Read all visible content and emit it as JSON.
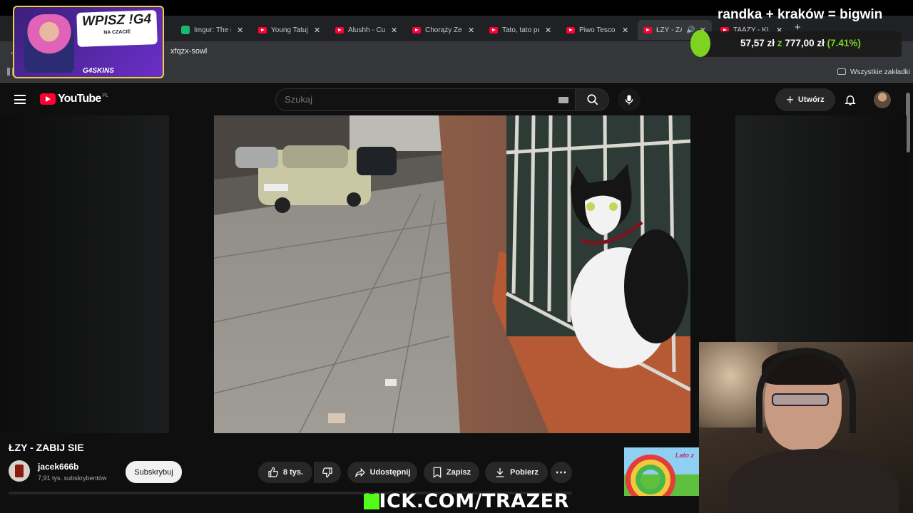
{
  "browser": {
    "tabs": [
      {
        "title": "Imgur: The m",
        "type": "imgur"
      },
      {
        "title": "Young Tatuje",
        "type": "youtube"
      },
      {
        "title": "Alushh - Cu",
        "type": "youtube"
      },
      {
        "title": "Chorąży Zep",
        "type": "youtube"
      },
      {
        "title": "Tato, tato pe",
        "type": "youtube"
      },
      {
        "title": "Piwo Tesco",
        "type": "youtube"
      },
      {
        "title": "ŁZY - ZA",
        "type": "youtube"
      },
      {
        "title": "TAAZY - KU",
        "type": "youtube"
      }
    ],
    "address_text": "xfqzx-sowl",
    "bookmarks_label": "Wszystkie zakładki"
  },
  "youtube": {
    "logo_text": "YouTube",
    "region": "PL",
    "search_placeholder": "Szukaj",
    "create_label": "Utwórz",
    "video_title": "ŁZY - ZABIJ SIE",
    "channel_name": "jacek666b",
    "subscribers": "7,91 tys. subskrybentów",
    "subscribe_label": "Subskrybuj",
    "likes": "8 tys.",
    "share_label": "Udostępnij",
    "save_label": "Zapisz",
    "download_label": "Pobierz"
  },
  "stream": {
    "promo_line1": "WPISZ !G4",
    "promo_line2": "NA CZACIE",
    "promo_brand": "G4SKINS",
    "top_right_title": "randka + kraków = bigwin",
    "progress_current": "57,57 zł",
    "progress_sep": "z",
    "progress_goal": "777,00 zł",
    "progress_percent": "(7.41%)",
    "kick_url": "KICK.COM/TRAZER",
    "mini_thumb_text": "Lato z"
  },
  "colors": {
    "youtube_red": "#ff0033",
    "progress_green": "#7ed321",
    "kick_green": "#53fc18"
  }
}
